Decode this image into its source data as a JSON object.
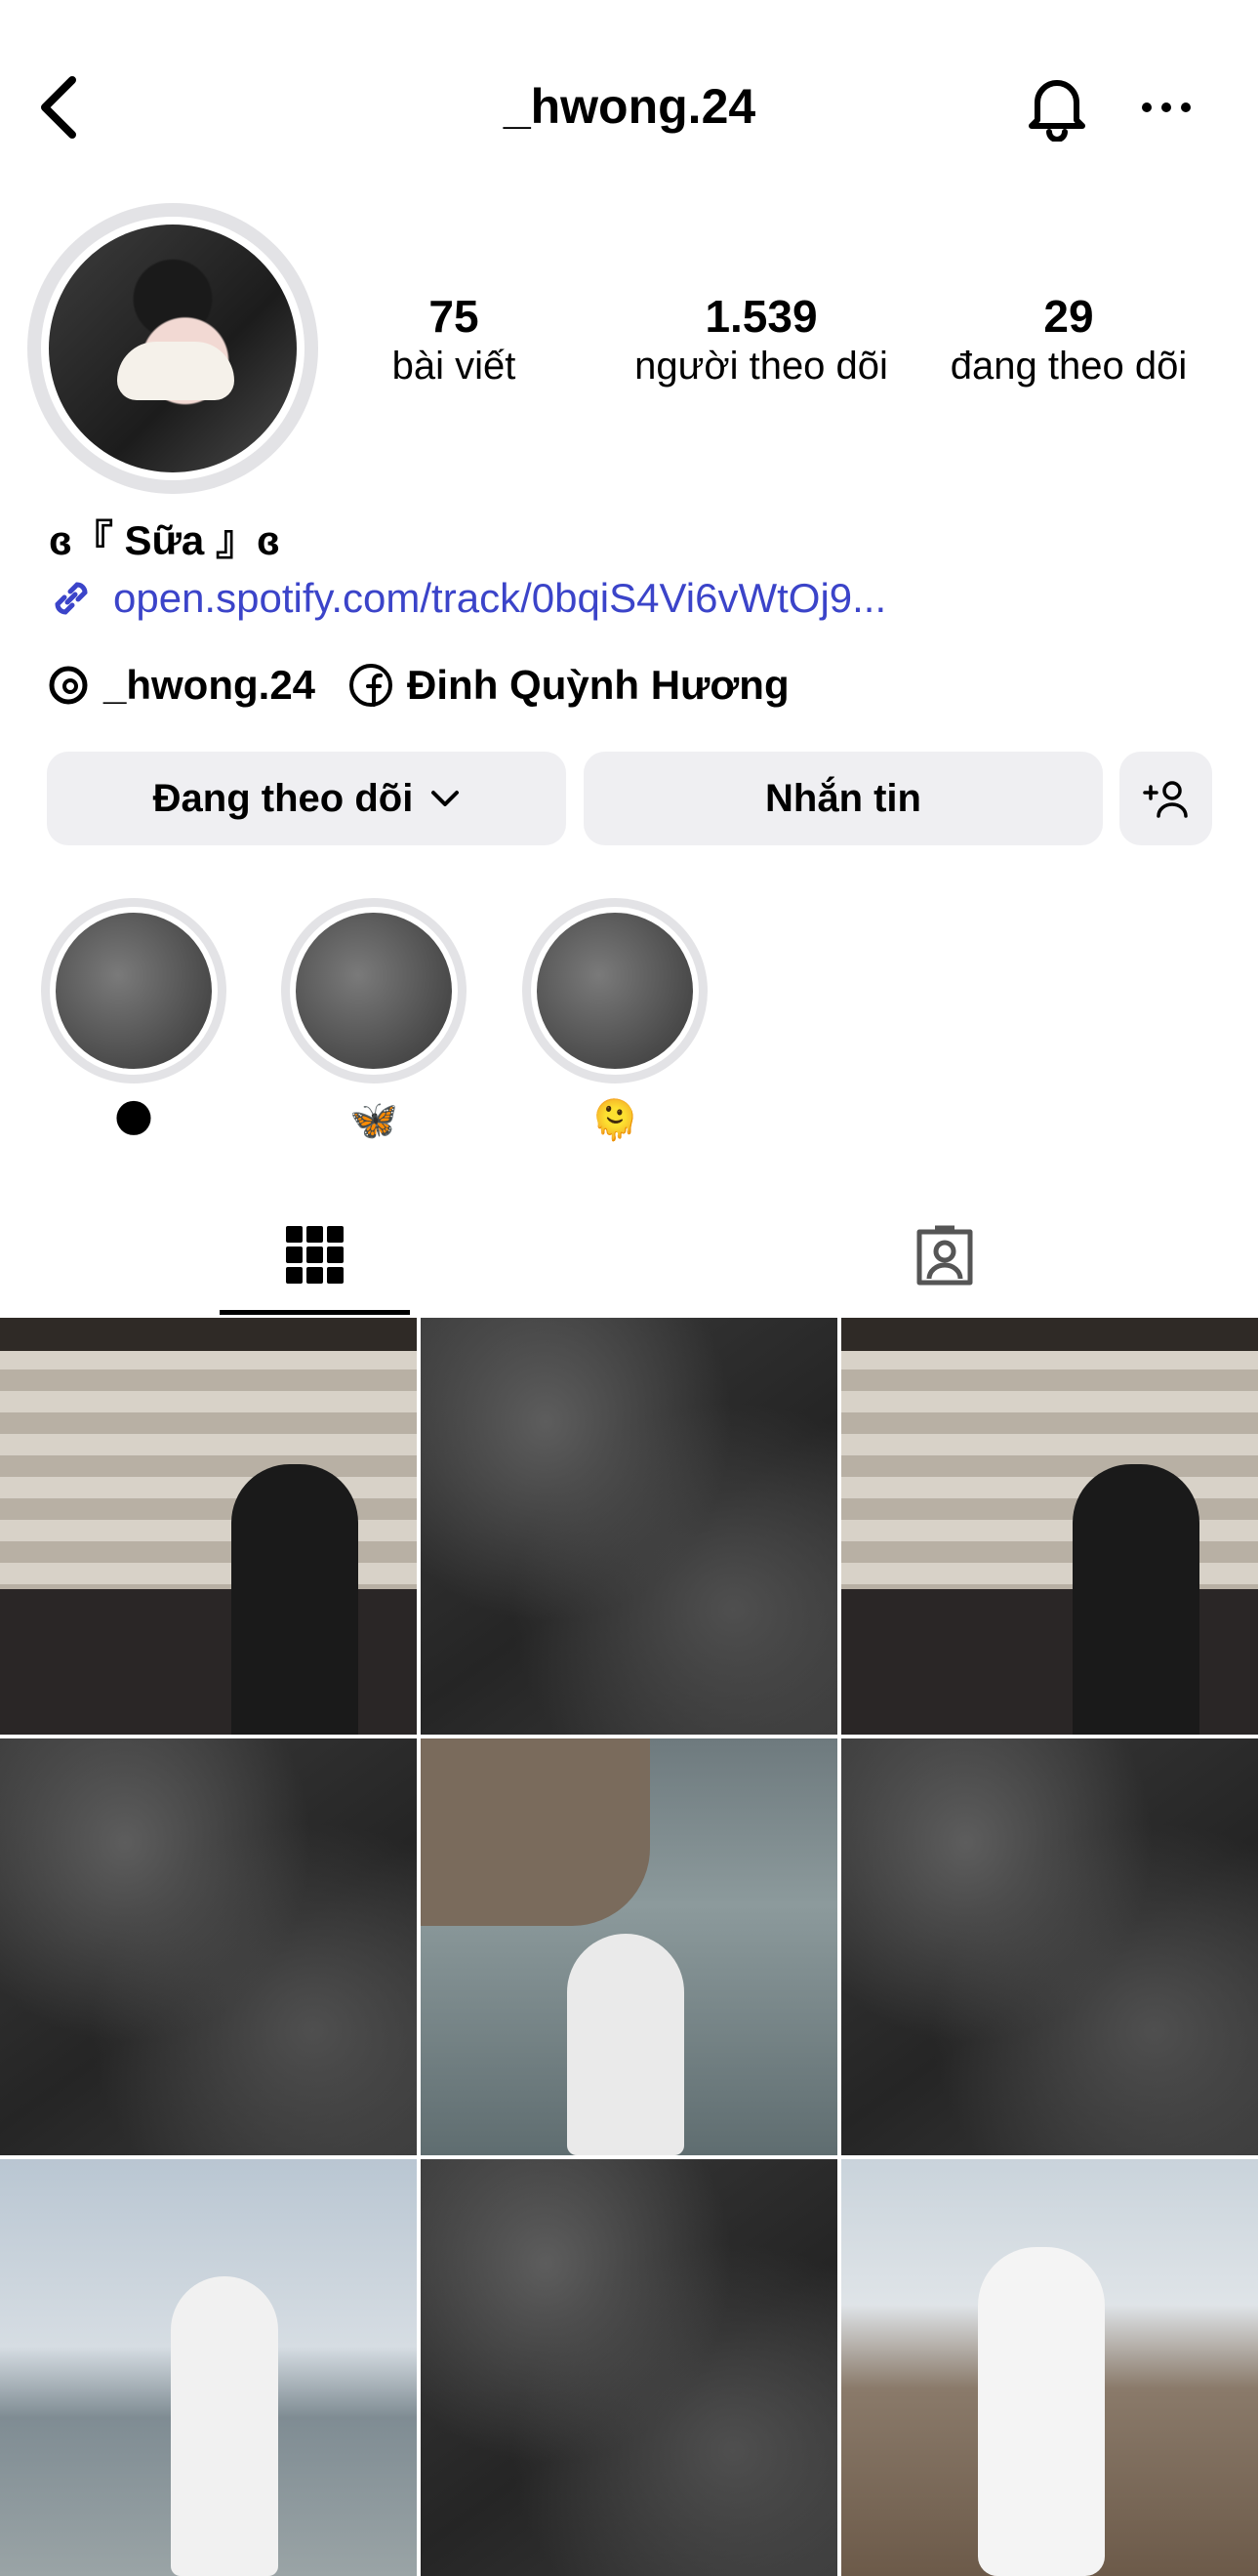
{
  "header": {
    "username": "_hwong.24"
  },
  "stats": {
    "posts_count": "75",
    "posts_label": "bài viết",
    "followers_count": "1.539",
    "followers_label": "người theo dõi",
    "following_count": "29",
    "following_label": "đang theo dõi"
  },
  "profile": {
    "display_name": "ɞ『 Sữa 』ɞ",
    "link": "open.spotify.com/track/0bqiS4Vi6vWtOj9...",
    "threads_handle": "_hwong.24",
    "facebook_name": "Đinh Quỳnh Hương"
  },
  "actions": {
    "following_label": "Đang theo dõi",
    "message_label": "Nhắn tin"
  },
  "highlights": [
    {
      "label": "🌑"
    },
    {
      "label": "🦋"
    },
    {
      "label": "🫠"
    }
  ],
  "icons": {
    "back": "chevron-left-icon",
    "bell": "bell-icon",
    "more": "more-horizontal-icon",
    "link": "link-icon",
    "threads": "threads-icon",
    "facebook": "facebook-icon",
    "chevron_down": "chevron-down-icon",
    "add_user": "add-user-icon",
    "grid": "grid-icon",
    "tagged": "tagged-person-icon"
  },
  "colors": {
    "link": "#3b44c9",
    "button_bg": "#efeff2"
  }
}
